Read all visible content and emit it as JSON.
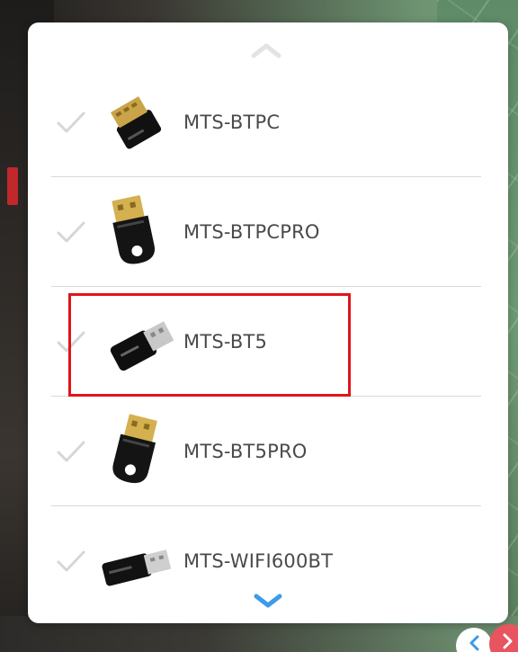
{
  "panel": {
    "items": [
      {
        "label": "MTS-BTPC",
        "icon": "bluetooth-dongle-small-icon"
      },
      {
        "label": "MTS-BTPCPRO",
        "icon": "bluetooth-dongle-pro-icon"
      },
      {
        "label": "MTS-BT5",
        "icon": "bluetooth-dongle-bt5-icon"
      },
      {
        "label": "MTS-BT5PRO",
        "icon": "bluetooth-dongle-bt5pro-icon"
      },
      {
        "label": "MTS-WIFI600BT",
        "icon": "wifi-dongle-icon"
      }
    ],
    "selected_index": 2
  },
  "colors": {
    "accent_blue": "#3d9be9",
    "highlight_red": "#e0141b",
    "check_gray": "#d6d6d6",
    "nav_red": "#e85560"
  }
}
